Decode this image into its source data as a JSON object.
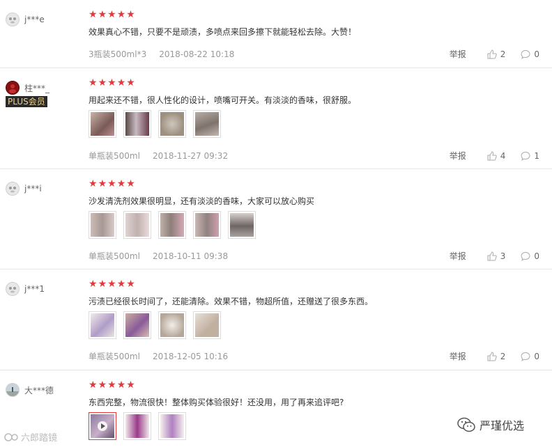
{
  "stars": [
    "★",
    "★",
    "★",
    "★",
    "★"
  ],
  "reviews": [
    {
      "user": "j***e",
      "plus": "",
      "text": "效果真心不错，只要不是顽渍，多喷点来回多擦下就能轻松去除。大赞！",
      "spec": "3瓶装500ml*3",
      "date": "2018-08-22 10:18",
      "report": "举报",
      "likes": "2",
      "comments": "0"
    },
    {
      "user": "柱***_",
      "plus": "PLUS会员",
      "text": "用起来还不错，很人性化的设计，喷嘴可开关。有淡淡的香味，很舒服。",
      "spec": "单瓶装500ml",
      "date": "2018-11-27 09:32",
      "report": "举报",
      "likes": "4",
      "comments": "1"
    },
    {
      "user": "j***i",
      "plus": "",
      "text": "沙发清洗剂效果很明显，还有淡淡的香味，大家可以放心购买",
      "spec": "单瓶装500ml",
      "date": "2018-10-11 09:38",
      "report": "举报",
      "likes": "3",
      "comments": "0"
    },
    {
      "user": "j***1",
      "plus": "",
      "text": "污渍已经很长时间了，还能清除。效果不错，物超所值，还赠送了很多东西。",
      "spec": "单瓶装500ml",
      "date": "2018-12-05 10:16",
      "report": "举报",
      "likes": "2",
      "comments": "0"
    },
    {
      "user": "大***德",
      "plus": "",
      "text": "东西完整，物流很快！整体购买体验很好！还没用，用了再来追评吧?",
      "spec": "",
      "date": "",
      "report": "",
      "likes": "",
      "comments": ""
    }
  ],
  "watermark": {
    "left": "六郎踏镜",
    "right": "严瑾优选"
  },
  "colors": {
    "star": "#e4393c",
    "plus_bg": "#2a2a2a",
    "plus_text": "#f0d28a"
  }
}
